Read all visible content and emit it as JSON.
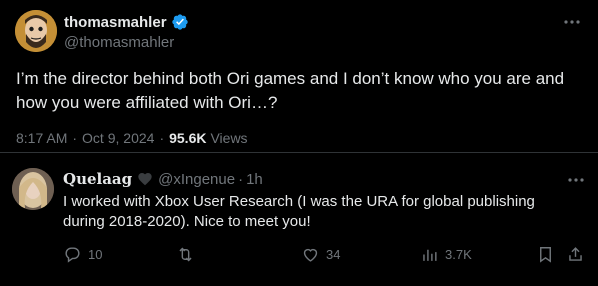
{
  "main_tweet": {
    "display_name": "thomasmahler",
    "handle": "@thomasmahler",
    "text": "I’m the director behind both Ori games and I don’t know who you are and how you were affiliated with Ori…?",
    "time": "8:17 AM",
    "separator": "·",
    "date": "Oct 9, 2024",
    "views_count": "95.6K",
    "views_label": "Views",
    "verified_color": "#1d9bf0"
  },
  "reply": {
    "display_name": "Quelaag",
    "handle": "@xIngenue",
    "dot": "·",
    "time": "1h",
    "text": "I worked with Xbox User Research (I was the URA for global publishing during 2018-2020). Nice to meet you!",
    "actions": {
      "replies": "10",
      "retweets": "",
      "likes": "34",
      "views": "3.7K"
    }
  },
  "colors": {
    "background": "#000000",
    "text_primary": "#e7e9ea",
    "text_secondary": "#71767b",
    "divider": "#2f3336"
  }
}
